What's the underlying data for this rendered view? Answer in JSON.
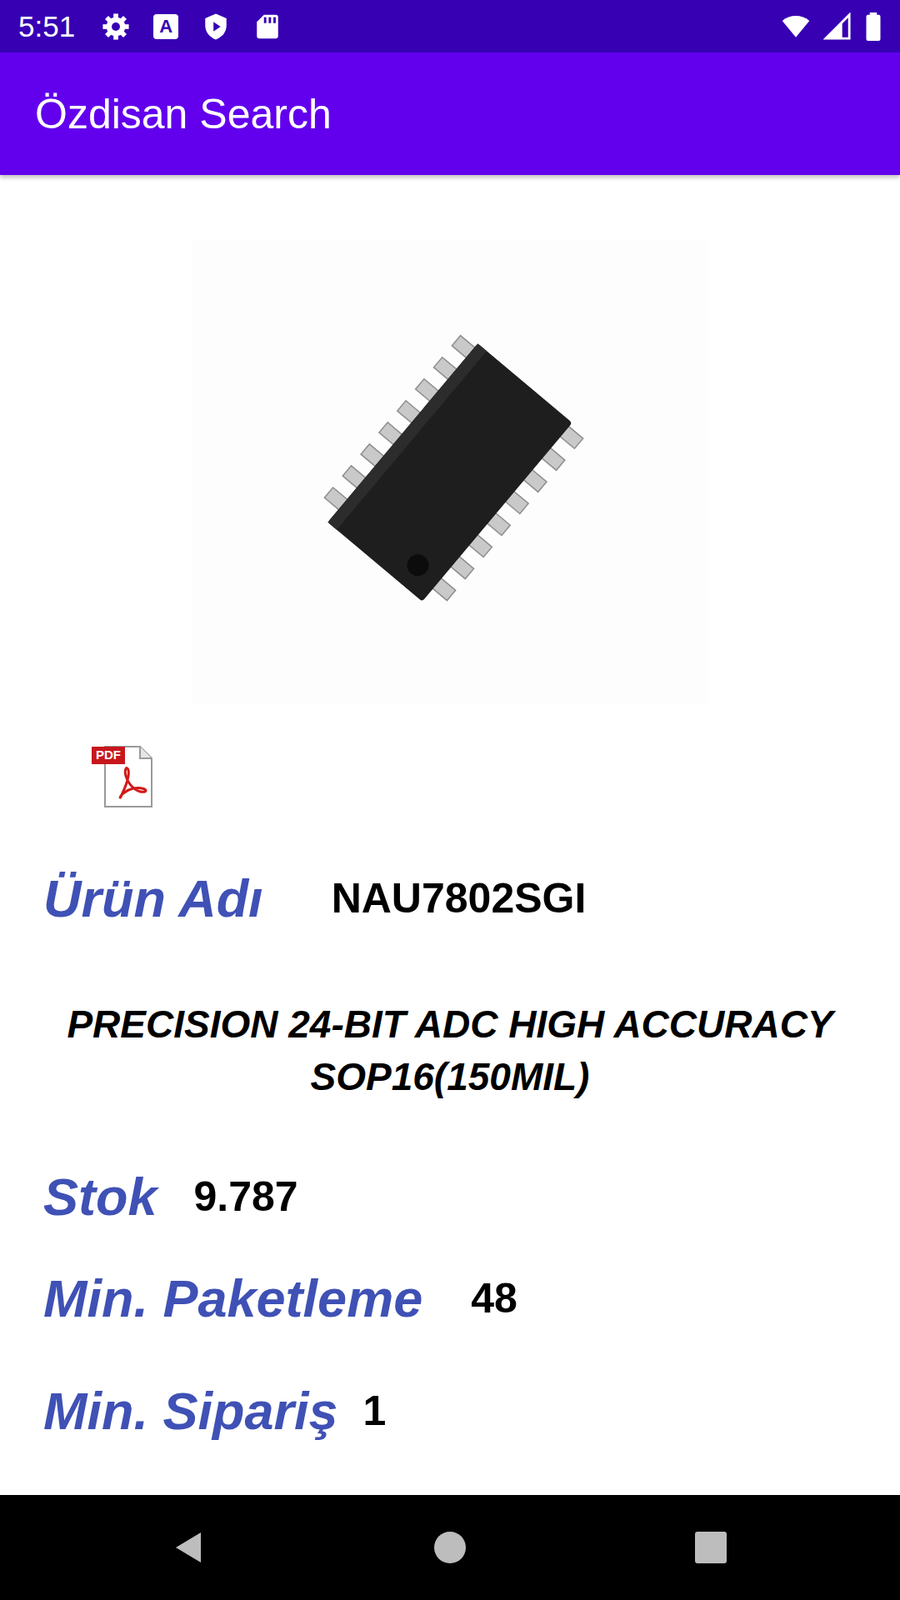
{
  "status_bar": {
    "time": "5:51",
    "notification_letter": "A"
  },
  "app_bar": {
    "title": "Özdisan Search"
  },
  "datasheet": {
    "badge": "PDF"
  },
  "product": {
    "name_label": "Ürün Adı",
    "name": "NAU7802SGI",
    "description": "PRECISION 24-BIT ADC HIGH ACCURACY SOP16(150MIL)"
  },
  "details": [
    {
      "label": "Stok",
      "value": "9.787"
    },
    {
      "label": "Min. Paketleme",
      "value": "48"
    },
    {
      "label": "Min. Sipariş",
      "value": "1"
    }
  ]
}
